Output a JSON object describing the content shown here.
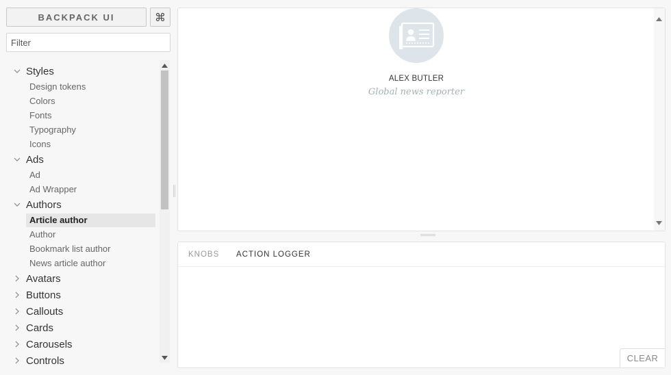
{
  "sidebar": {
    "brand_label": "BACKPACK UI",
    "shortcut_icon": "command-key-icon",
    "filter_placeholder": "Filter",
    "kinds": [
      {
        "label": "Styles",
        "expanded": true,
        "stories": [
          {
            "label": "Design tokens"
          },
          {
            "label": "Colors"
          },
          {
            "label": "Fonts"
          },
          {
            "label": "Typography"
          },
          {
            "label": "Icons"
          }
        ]
      },
      {
        "label": "Ads",
        "expanded": true,
        "stories": [
          {
            "label": "Ad"
          },
          {
            "label": "Ad Wrapper"
          }
        ]
      },
      {
        "label": "Authors",
        "expanded": true,
        "stories": [
          {
            "label": "Article author",
            "selected": true
          },
          {
            "label": "Author"
          },
          {
            "label": "Bookmark list author"
          },
          {
            "label": "News article author"
          }
        ]
      },
      {
        "label": "Avatars",
        "expanded": false,
        "stories": []
      },
      {
        "label": "Buttons",
        "expanded": false,
        "stories": []
      },
      {
        "label": "Callouts",
        "expanded": false,
        "stories": []
      },
      {
        "label": "Cards",
        "expanded": false,
        "stories": []
      },
      {
        "label": "Carousels",
        "expanded": false,
        "stories": []
      },
      {
        "label": "Controls",
        "expanded": false,
        "stories": []
      }
    ]
  },
  "preview": {
    "avatar_icon": "contact-card-icon",
    "author_name": "ALEX BUTLER",
    "author_title": "Global news reporter"
  },
  "addons": {
    "tabs": [
      {
        "label": "KNOBS",
        "active": false
      },
      {
        "label": "ACTION LOGGER",
        "active": true
      }
    ],
    "clear_label": "CLEAR"
  },
  "colors": {
    "background": "#f7f7f7",
    "panel": "#ffffff",
    "avatar_bg": "#dde5ea",
    "muted_text": "#a6b0b8",
    "selected_bg": "#e6e6e6"
  }
}
